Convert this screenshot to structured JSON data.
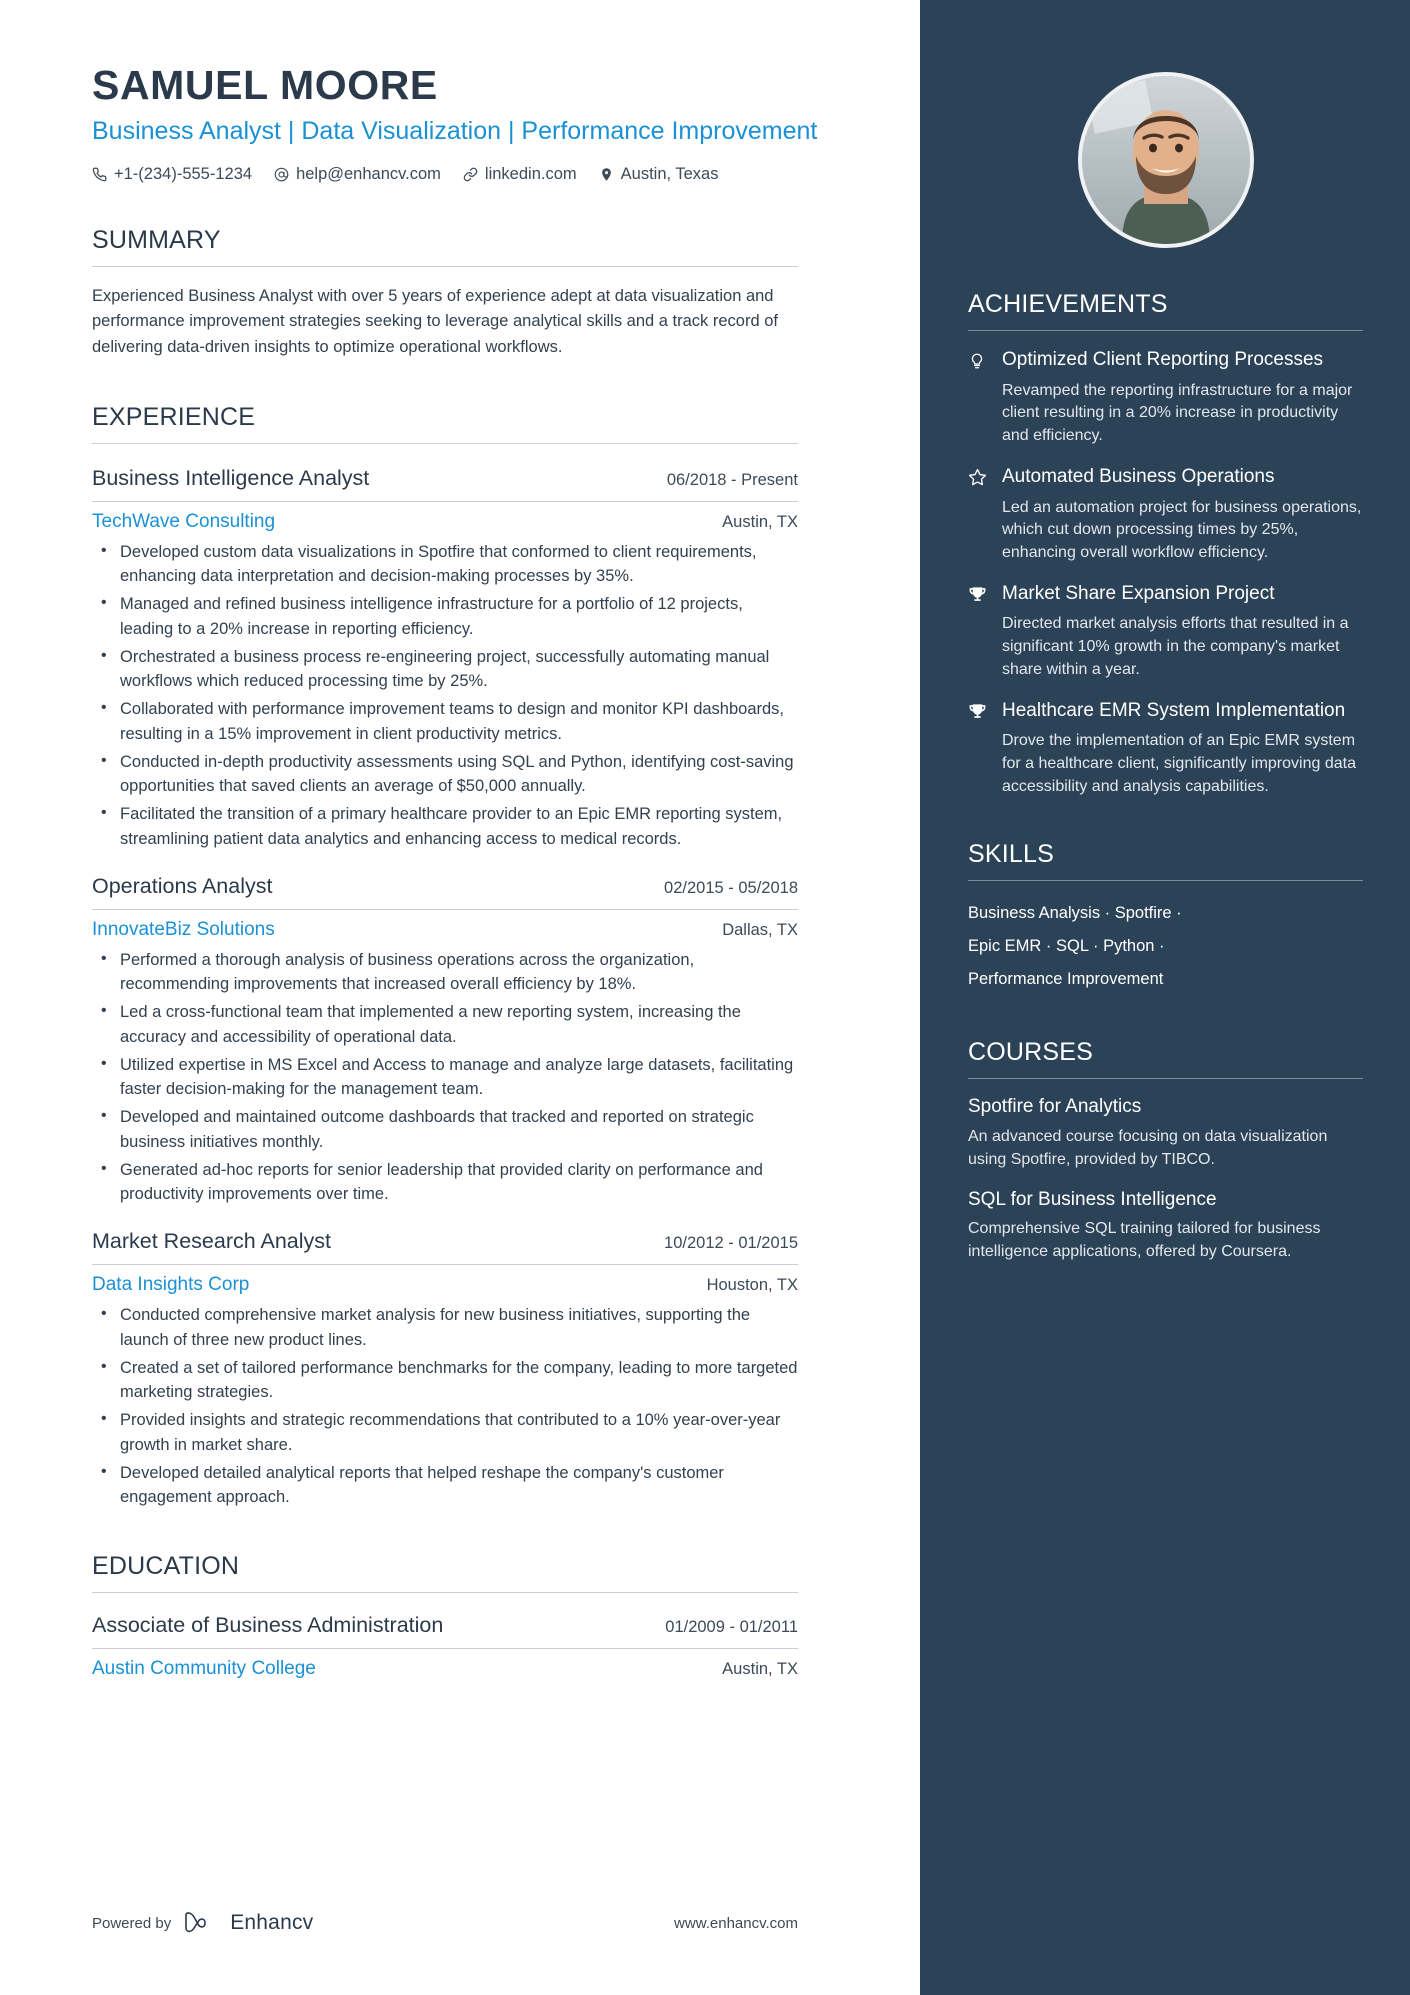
{
  "header": {
    "name": "SAMUEL MOORE",
    "headline": "Business Analyst | Data Visualization | Performance Improvement",
    "contacts": [
      {
        "icon": "phone-icon",
        "text": "+1-(234)-555-1234"
      },
      {
        "icon": "email-icon",
        "text": "help@enhancv.com"
      },
      {
        "icon": "link-icon",
        "text": "linkedin.com"
      },
      {
        "icon": "location-pin-icon",
        "text": "Austin, Texas"
      }
    ]
  },
  "summary": {
    "title": "SUMMARY",
    "text": "Experienced Business Analyst with over 5 years of experience adept at data visualization and performance improvement strategies seeking to leverage analytical skills and a track record of delivering data-driven insights to optimize operational workflows."
  },
  "experience": {
    "title": "EXPERIENCE",
    "jobs": [
      {
        "title": "Business Intelligence Analyst",
        "date": "06/2018 - Present",
        "company": "TechWave Consulting",
        "location": "Austin, TX",
        "bullets": [
          "Developed custom data visualizations in Spotfire that conformed to client requirements, enhancing data interpretation and decision-making processes by 35%.",
          "Managed and refined business intelligence infrastructure for a portfolio of 12 projects, leading to a 20% increase in reporting efficiency.",
          "Orchestrated a business process re-engineering project, successfully automating manual workflows which reduced processing time by 25%.",
          "Collaborated with performance improvement teams to design and monitor KPI dashboards, resulting in a 15% improvement in client productivity metrics.",
          "Conducted in-depth productivity assessments using SQL and Python, identifying cost-saving opportunities that saved clients an average of $50,000 annually.",
          "Facilitated the transition of a primary healthcare provider to an Epic EMR reporting system, streamlining patient data analytics and enhancing access to medical records."
        ]
      },
      {
        "title": "Operations Analyst",
        "date": "02/2015 - 05/2018",
        "company": "InnovateBiz Solutions",
        "location": "Dallas, TX",
        "bullets": [
          "Performed a thorough analysis of business operations across the organization, recommending improvements that increased overall efficiency by 18%.",
          "Led a cross-functional team that implemented a new reporting system, increasing the accuracy and accessibility of operational data.",
          "Utilized expertise in MS Excel and Access to manage and analyze large datasets, facilitating faster decision-making for the management team.",
          "Developed and maintained outcome dashboards that tracked and reported on strategic business initiatives monthly.",
          "Generated ad-hoc reports for senior leadership that provided clarity on performance and productivity improvements over time."
        ]
      },
      {
        "title": "Market Research Analyst",
        "date": "10/2012 - 01/2015",
        "company": "Data Insights Corp",
        "location": "Houston, TX",
        "bullets": [
          "Conducted comprehensive market analysis for new business initiatives, supporting the launch of three new product lines.",
          "Created a set of tailored performance benchmarks for the company, leading to more targeted marketing strategies.",
          "Provided insights and strategic recommendations that contributed to a 10% year-over-year growth in market share.",
          "Developed detailed analytical reports that helped reshape the company's customer engagement approach."
        ]
      }
    ]
  },
  "education": {
    "title": "EDUCATION",
    "entries": [
      {
        "degree": "Associate of Business Administration",
        "date": "01/2009 - 01/2011",
        "school": "Austin Community College",
        "location": "Austin, TX"
      }
    ]
  },
  "footer": {
    "powered_by": "Powered by",
    "brand": "Enhancv",
    "website": "www.enhancv.com"
  },
  "achievements": {
    "title": "ACHIEVEMENTS",
    "items": [
      {
        "icon": "lightbulb-icon",
        "title": "Optimized Client Reporting Processes",
        "desc": "Revamped the reporting infrastructure for a major client resulting in a 20% increase in productivity and efficiency."
      },
      {
        "icon": "star-icon",
        "title": "Automated Business Operations",
        "desc": "Led an automation project for business operations, which cut down processing times by 25%, enhancing overall workflow efficiency."
      },
      {
        "icon": "trophy-icon",
        "title": "Market Share Expansion Project",
        "desc": "Directed market analysis efforts that resulted in a significant 10% growth in the company's market share within a year."
      },
      {
        "icon": "trophy-icon",
        "title": "Healthcare EMR System Implementation",
        "desc": "Drove the implementation of an Epic EMR system for a healthcare client, significantly improving data accessibility and analysis capabilities."
      }
    ]
  },
  "skills": {
    "title": "SKILLS",
    "lines": [
      "Business Analysis · Spotfire ·",
      "Epic EMR · SQL · Python ·",
      "Performance Improvement"
    ]
  },
  "courses": {
    "title": "COURSES",
    "items": [
      {
        "name": "Spotfire for Analytics",
        "desc": "An advanced course focusing on data visualization using Spotfire, provided by TIBCO."
      },
      {
        "name": "SQL for Business Intelligence",
        "desc": "Comprehensive SQL training tailored for business intelligence applications, offered by Coursera."
      }
    ]
  },
  "colors": {
    "accent": "#1a91d6",
    "sidebar": "#2c4257",
    "heading": "#2b3a4a",
    "body": "#33414f"
  }
}
